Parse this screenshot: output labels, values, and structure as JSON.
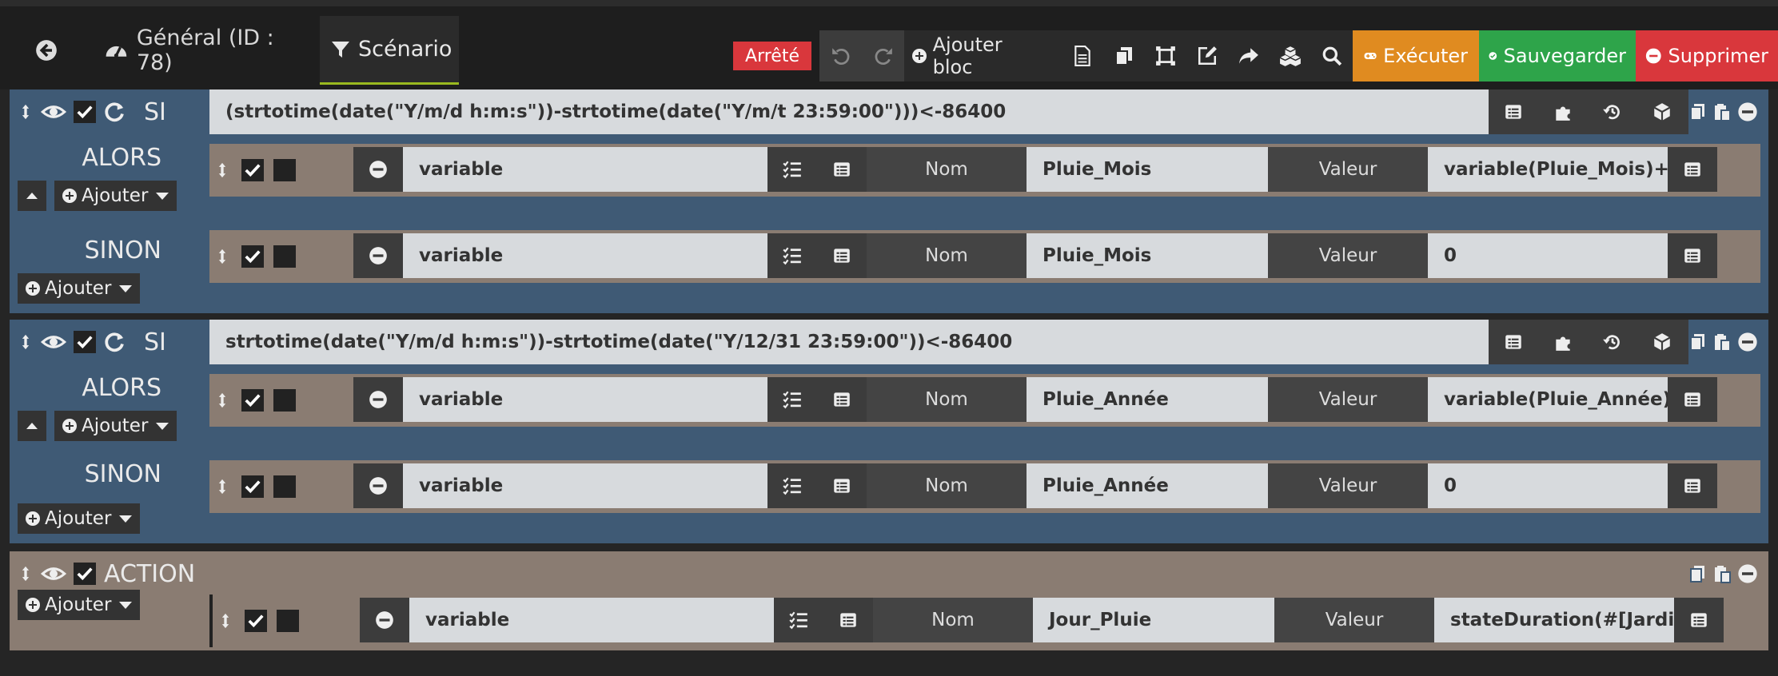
{
  "header": {
    "tab_general": "Général (ID : 78)",
    "tab_scenario": "Scénario",
    "status": "Arrêté",
    "status_color": "#d9373c"
  },
  "toolbar": {
    "add_block": "Ajouter bloc",
    "execute": "Exécuter",
    "save": "Sauvegarder",
    "delete": "Supprimer",
    "execute_color": "#e08b20",
    "save_color": "#2ea44a",
    "delete_color": "#d9373c"
  },
  "blocks": [
    {
      "type": "SI",
      "condition": "(strtotime(date(\"Y/m/d h:m:s\"))-strtotime(date(\"Y/m/t 23:59:00\")))<-86400",
      "alors_label": "ALORS",
      "sinon_label": "SINON",
      "add_label": "Ajouter",
      "alors": {
        "expression": "variable",
        "nom_label": "Nom",
        "nom": "Pluie_Mois",
        "valeur_label": "Valeur",
        "valeur": "variable(Pluie_Mois)+#[Jardin]["
      },
      "sinon": {
        "expression": "variable",
        "nom_label": "Nom",
        "nom": "Pluie_Mois",
        "valeur_label": "Valeur",
        "valeur": "0"
      }
    },
    {
      "type": "SI",
      "condition": "strtotime(date(\"Y/m/d h:m:s\"))-strtotime(date(\"Y/12/31 23:59:00\"))<-86400",
      "alors_label": "ALORS",
      "sinon_label": "SINON",
      "add_label": "Ajouter",
      "alors": {
        "expression": "variable",
        "nom_label": "Nom",
        "nom": "Pluie_Année",
        "valeur_label": "Valeur",
        "valeur": "variable(Pluie_Année)+#"
      },
      "sinon": {
        "expression": "variable",
        "nom_label": "Nom",
        "nom": "Pluie_Année",
        "valeur_label": "Valeur",
        "valeur": "0"
      }
    },
    {
      "type": "ACTION",
      "add_label": "Ajouter",
      "action": {
        "expression": "variable",
        "nom_label": "Nom",
        "nom": "Jour_Pluie",
        "valeur_label": "Valeur",
        "valeur": "stateDuration(#[Jardin][S"
      }
    }
  ]
}
